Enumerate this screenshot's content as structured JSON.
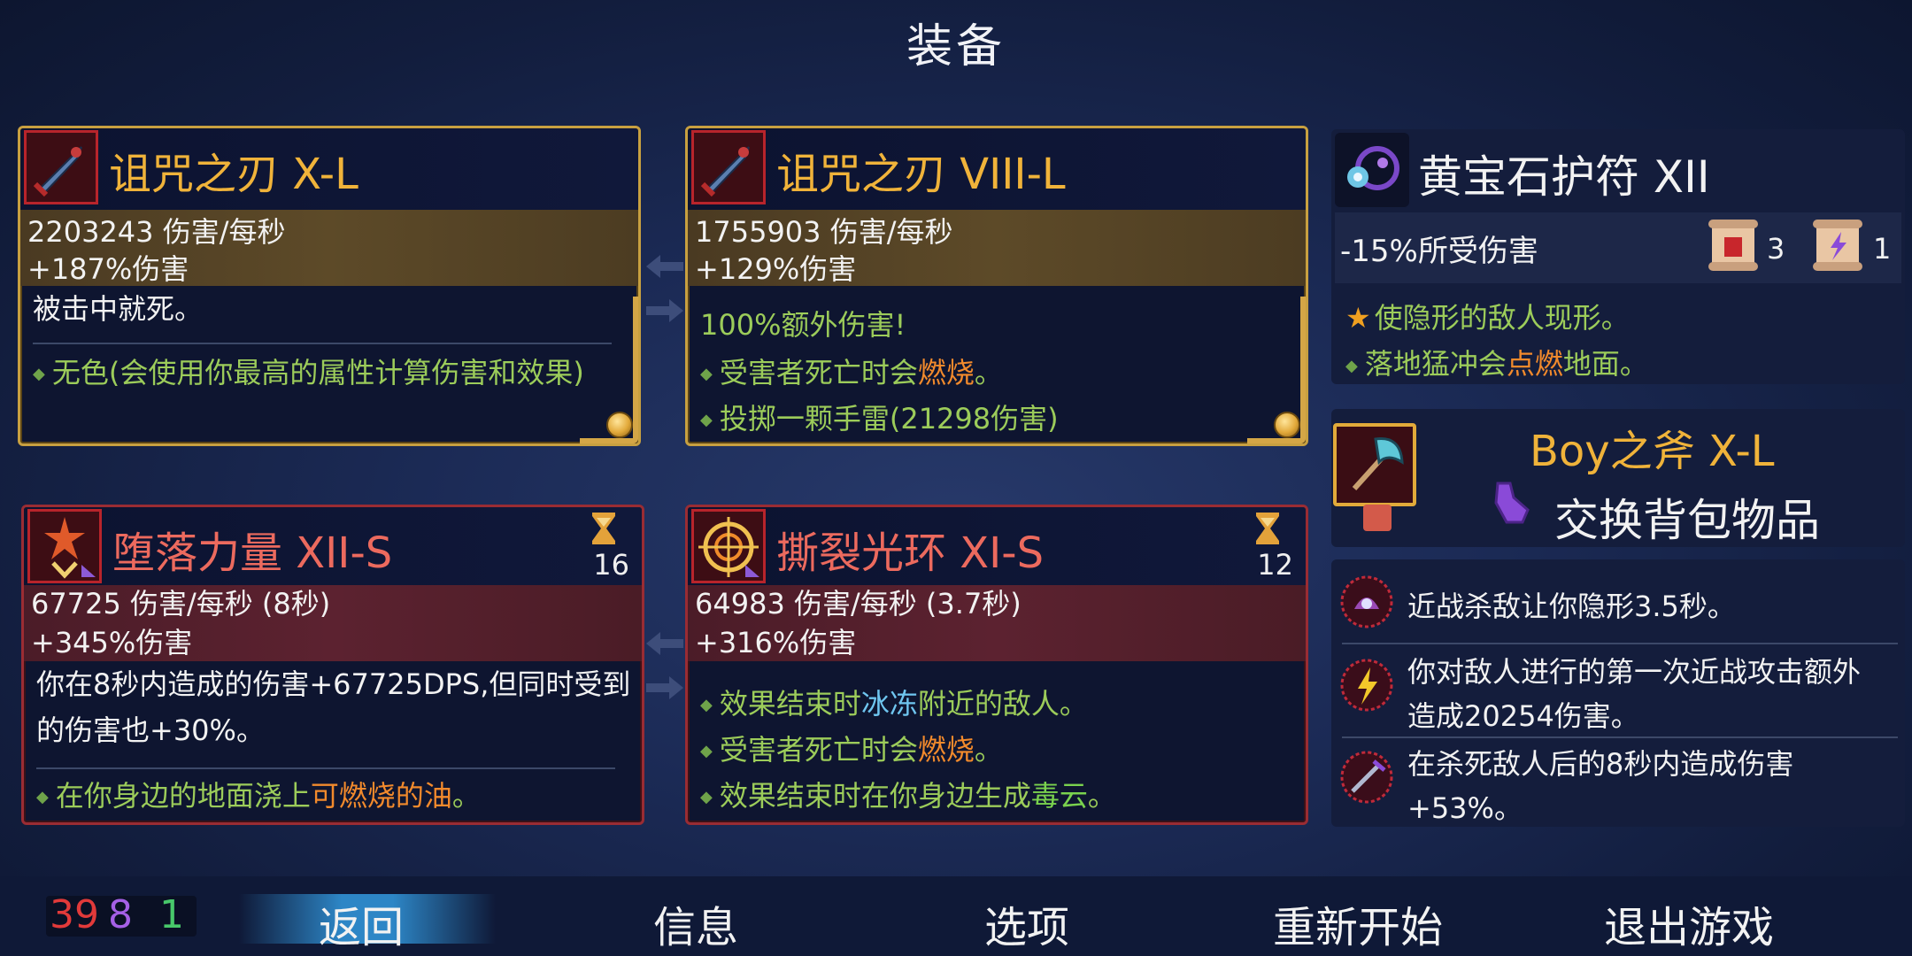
{
  "title": "装备",
  "weapons": [
    {
      "name": "诅咒之刃 X-L",
      "dps": "2203243 伤害/每秒",
      "bonus": "+187%伤害",
      "desc": "被击中就死。",
      "traits": [
        "无色(会使用你最高的属性计算伤害和效果)"
      ],
      "icon": "cursed-sword-icon"
    },
    {
      "name": "诅咒之刃 VIII-L",
      "dps": "1755903 伤害/每秒",
      "bonus": "+129%伤害",
      "desc_partial": "100%额外伤害!",
      "traits": {
        "t1_pre": "受害者死亡时会",
        "t1_hl": "燃烧",
        "t1_post": "。",
        "t2": "投掷一颗手雷(21298伤害)"
      },
      "icon": "cursed-sword-icon"
    }
  ],
  "skills": [
    {
      "name": "堕落力量 XII-S",
      "cooldown": "16",
      "dps": "67725 伤害/每秒 (8秒)",
      "bonus": "+345%伤害",
      "desc": "你在8秒内造成的伤害+67725DPS,但同时受到的伤害也+30%。",
      "trait_pre": "在你身边的地面浇上",
      "trait_hl": "可燃烧的油",
      "trait_post": "。",
      "icon": "fallen-power-icon"
    },
    {
      "name": "撕裂光环 XI-S",
      "cooldown": "12",
      "dps": "64983 伤害/每秒 (3.7秒)",
      "bonus": "+316%伤害",
      "traits": {
        "t1_pre": "效果结束时",
        "t1_hl": "冰冻",
        "t1_post": "附近的敌人。",
        "t2_pre": "受害者死亡时会",
        "t2_hl": "燃烧",
        "t2_post": "。",
        "t3_pre": "效果结束时在你身边生成",
        "t3_hl": "毒云",
        "t3_post": "。"
      },
      "icon": "tearing-aura-icon"
    }
  ],
  "amulet": {
    "name": "黄宝石护符 XII",
    "stat": "-15%所受伤害",
    "scroll_red_count": "3",
    "scroll_purple_count": "1",
    "trait1": "使隐形的敌人现形。",
    "trait2_pre": "落地猛冲会",
    "trait2_hl": "点燃",
    "trait2_post": "地面。"
  },
  "backpack": {
    "name": "Boy之斧 X-L",
    "action": "交换背包物品"
  },
  "mutations": [
    {
      "text": "近战杀敌让你隐形3.5秒。",
      "icon": "stealth-mutation-icon"
    },
    {
      "text": "你对敌人进行的第一次近战攻击额外造成20254伤害。",
      "icon": "lightning-mutation-icon"
    },
    {
      "text": "在杀死敌人后的8秒内造成伤害+53%。",
      "icon": "killer-instinct-icon"
    }
  ],
  "scrolls": {
    "brutality": "39",
    "tactics": "8",
    "survival": "1"
  },
  "menu": {
    "back": "返回",
    "info": "信息",
    "options": "选项",
    "restart": "重新开始",
    "quit": "退出游戏"
  },
  "colors": {
    "gold": "#f0b33a",
    "red_name": "#ec6a5e",
    "trait_green": "#9ccc5a",
    "fire": "#f28a2c",
    "ice": "#6fc6f0",
    "brutality": "#e23a3a",
    "tactics": "#a560e6",
    "survival": "#48c86a"
  }
}
